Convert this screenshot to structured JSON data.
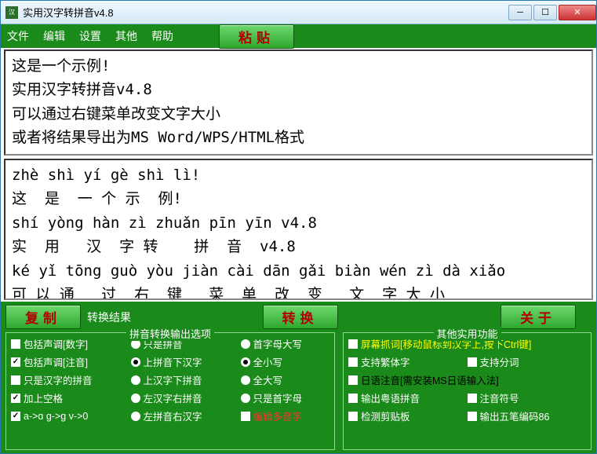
{
  "window": {
    "title": "实用汉字转拼音v4.8",
    "icon_text": "汉"
  },
  "menu": [
    "文件",
    "编辑",
    "设置",
    "其他",
    "帮助"
  ],
  "paste_button": "粘贴",
  "input_text": "这是一个示例!\n实用汉字转拼音v4.8\n可以通过右键菜单改变文字大小\n或者将结果导出为MS Word/WPS/HTML格式",
  "output_text": "zhè shì yí gè shì lì!\n这  是  一 个 示  例!\nshí yòng hàn zì zhuǎn pīn yīn v4.8\n实  用   汉  字 转    拼  音  v4.8\nké yǐ tōng guò yòu jiàn cài dān gǎi biàn wén zì dà xiǎo\n可 以 通   过  右  键   菜  单  改  变   文  字 大 小",
  "copy_button": "复制",
  "convert_result_label": "转换结果",
  "convert_button": "转换",
  "about_button": "关于",
  "group1": {
    "title": "拼音转换输出选项",
    "col1": [
      {
        "label": "包括声调[数字]",
        "type": "check",
        "checked": false,
        "color": "white"
      },
      {
        "label": "包括声调[注音]",
        "type": "check",
        "checked": true,
        "color": "white"
      },
      {
        "label": "只是汉字的拼音",
        "type": "check",
        "checked": false,
        "color": "white"
      },
      {
        "label": "加上空格",
        "type": "check",
        "checked": true,
        "color": "white"
      },
      {
        "label": "a->ɑ g->ɡ v->0",
        "type": "check",
        "checked": true,
        "color": "white"
      }
    ],
    "col2": [
      {
        "label": "只是拼音",
        "type": "radio",
        "checked": false,
        "color": "white"
      },
      {
        "label": "上拼音下汉字",
        "type": "radio",
        "checked": true,
        "color": "white"
      },
      {
        "label": "上汉字下拼音",
        "type": "radio",
        "checked": false,
        "color": "white"
      },
      {
        "label": "左汉字右拼音",
        "type": "radio",
        "checked": false,
        "color": "white"
      },
      {
        "label": "左拼音右汉字",
        "type": "radio",
        "checked": false,
        "color": "white"
      }
    ],
    "col3": [
      {
        "label": "首字母大写",
        "type": "radio",
        "checked": false,
        "color": "white"
      },
      {
        "label": "全小写",
        "type": "radio",
        "checked": true,
        "color": "white"
      },
      {
        "label": "全大写",
        "type": "radio",
        "checked": false,
        "color": "white"
      },
      {
        "label": "只是首字母",
        "type": "radio",
        "checked": false,
        "color": "white"
      },
      {
        "label": "编辑多音字",
        "type": "check",
        "checked": false,
        "color": "red"
      }
    ]
  },
  "group2": {
    "title": "其他实用功能",
    "items": [
      {
        "label": "屏幕抓词[移动鼠标到汉字上,按下Ctrl键]",
        "type": "check",
        "checked": false,
        "color": "yellow",
        "span": 2
      },
      {
        "label": "支持繁体字",
        "type": "check",
        "checked": false,
        "color": "white"
      },
      {
        "label": "支持分词",
        "type": "check",
        "checked": false,
        "color": "white"
      },
      {
        "label": "日语注音[需安装MS日语输入法]",
        "type": "check",
        "checked": false,
        "color": "black",
        "span": 2
      },
      {
        "label": "输出粤语拼音",
        "type": "check",
        "checked": false,
        "color": "white"
      },
      {
        "label": "注音符号",
        "type": "check",
        "checked": false,
        "color": "white"
      },
      {
        "label": "检测剪贴板",
        "type": "check",
        "checked": false,
        "color": "white"
      },
      {
        "label": "输出五笔编码86",
        "type": "check",
        "checked": false,
        "color": "white"
      }
    ]
  }
}
